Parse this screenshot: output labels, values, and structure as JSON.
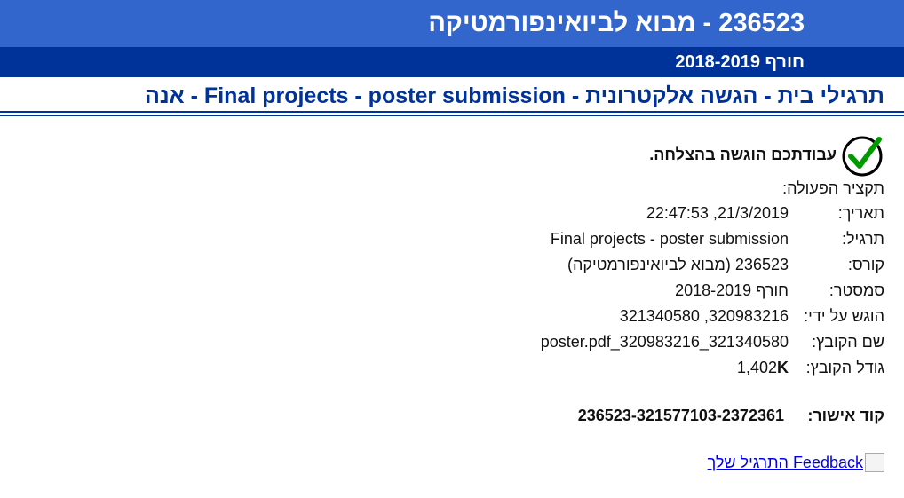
{
  "header": {
    "course_title": "236523 - מבוא לביואינפורמטיקה",
    "semester": "חורף 2018-2019"
  },
  "breadcrumb": "תרגילי בית - הגשה אלקטרונית - Final projects - poster submission - אנה",
  "success_message": "עבודתכם הוגשה בהצלחה.",
  "summary_title": "תקציר הפעולה:",
  "details": {
    "date_label": "תאריך:",
    "date_value": "21/3/2019, 22:47:53",
    "exercise_label": "תרגיל:",
    "exercise_value": "Final projects - poster submission",
    "course_label": "קורס:",
    "course_value": "236523 (מבוא לביואינפורמטיקה)",
    "semester_label": "סמסטר:",
    "semester_value": "חורף 2018-2019",
    "submitted_by_label": "הוגש על ידי:",
    "submitted_by_value": "320983216, 321340580",
    "filename_label": "שם הקובץ:",
    "filename_value": "poster.pdf_320983216_321340580",
    "filesize_label": "גודל הקובץ:",
    "filesize_number": "1,402",
    "filesize_unit": "K"
  },
  "approval": {
    "label": "קוד אישור:",
    "value": "236523-321577103-2372361"
  },
  "feedback_link": "Feedback התרגיל שלך",
  "icons": {
    "success": "checkmark-circle-icon",
    "feedback": "broken-image-icon"
  },
  "colors": {
    "header_light": "#3366cc",
    "header_dark": "#003399",
    "breadcrumb": "#003399",
    "check": "#009900",
    "link": "#0000ee"
  }
}
